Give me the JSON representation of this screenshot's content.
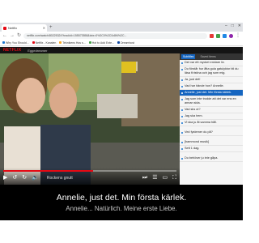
{
  "browser": {
    "tab_title": "Netflix",
    "url": "netflix.com/watch/80225324?trackId=155573558&tctx=0%2C0%2C0c8f4%2C...",
    "bookmarks": [
      "Why You Should...",
      "Netflix - Kanalen",
      "Teknikens Hus s...",
      "Hot to Add Exte...",
      "Dreamhost"
    ]
  },
  "netflix": {
    "logo": "NETFLIX",
    "title": "Eggedreamer"
  },
  "player": {
    "episode_title": "Rockens gnutt",
    "progress_percent": 52
  },
  "side_panel": {
    "tabs": [
      "Subtitles",
      "Saved items"
    ],
    "active_tab": 0,
    "lines": [
      "Det var ett mycket enklare liv.",
      "Du förstår hur åtta gula gatulyktor bli du läsa Kristina och jag som mig.",
      "Ja, just det!",
      "Vad har hände hon? Annelie.",
      "Annelie, just det. Min första kärlek.",
      "Jag som inte trodde att det var ens en annan sida.",
      "Vad sks ut?",
      "Jag ska hem.",
      "Vi ska ju åt samma håll.",
      "Ved fystemer du på?",
      "[hammond musik]",
      "Sett 1 dag.",
      "Du behöver ju inte gåpa."
    ],
    "active_line": 4
  },
  "subtitles": {
    "primary": "Annelie, just det. Min första kärlek.",
    "secondary": "Annelie... Natürlich. Meine erste Liebe."
  }
}
